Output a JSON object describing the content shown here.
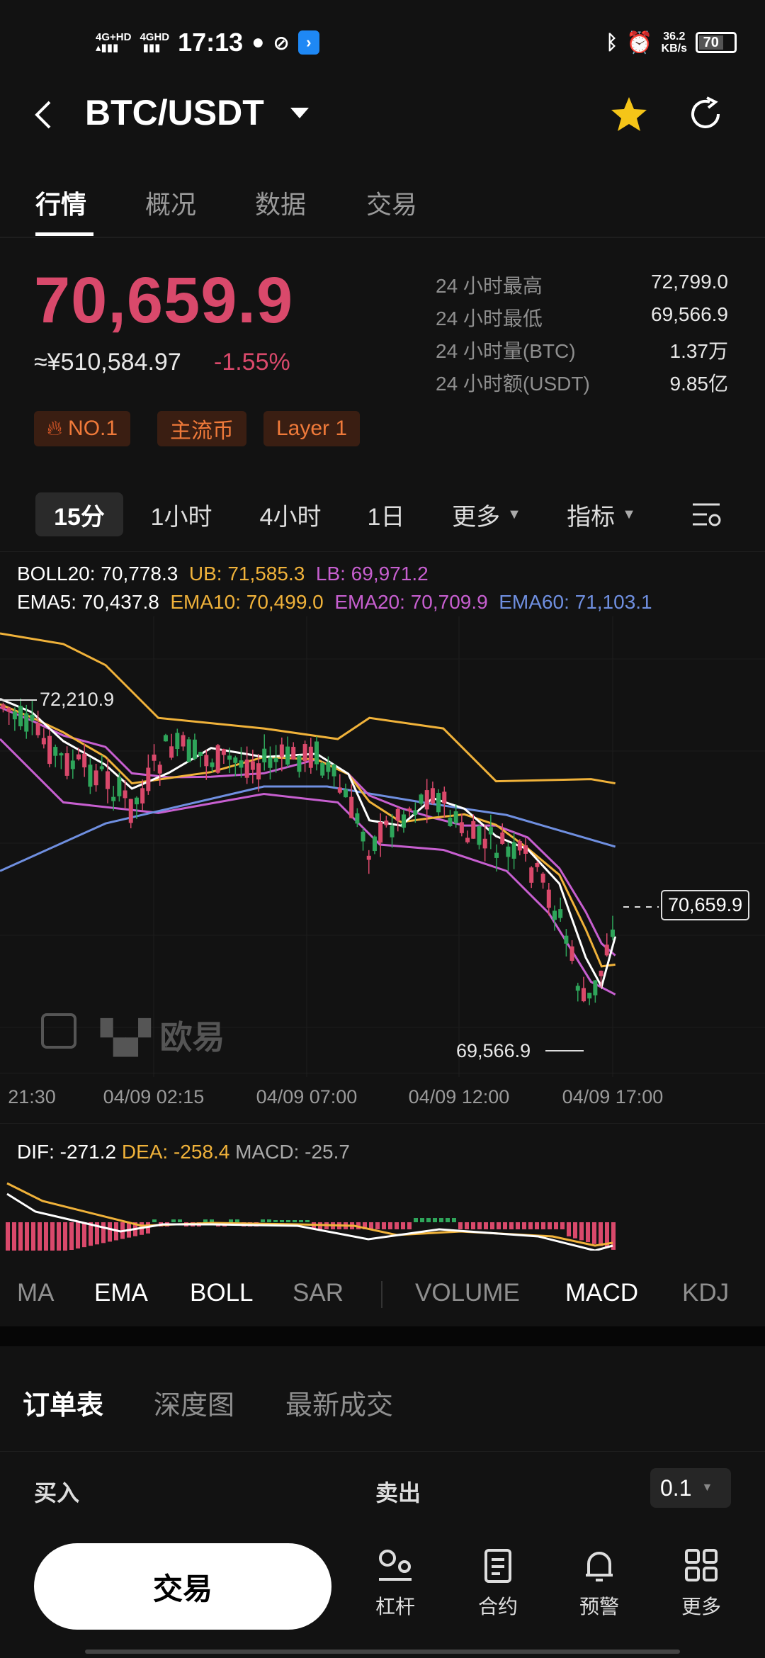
{
  "status_bar": {
    "net1": "4G+HD",
    "net2": "4GHD",
    "time": "17:13",
    "speed_value": "36.2",
    "speed_unit": "KB/s",
    "battery": "70"
  },
  "header": {
    "title": "BTC/USDT"
  },
  "tabs": [
    "行情",
    "概况",
    "数据",
    "交易"
  ],
  "ticker": {
    "price": "70,659.9",
    "cny": "≈¥510,584.97",
    "change": "-1.55%",
    "stats": [
      {
        "label": "24 小时最高",
        "value": "72,799.0"
      },
      {
        "label": "24 小时最低",
        "value": "69,566.9"
      },
      {
        "label": "24 小时量(BTC)",
        "value": "1.37万"
      },
      {
        "label": "24 小时额(USDT)",
        "value": "9.85亿"
      }
    ],
    "badges": [
      "NO.1",
      "主流币",
      "Layer 1"
    ]
  },
  "timeframes": {
    "items": [
      "15分",
      "1小时",
      "4小时",
      "1日"
    ],
    "more": "更多",
    "indicators": "指标"
  },
  "legend": {
    "boll": "BOLL20: 70,778.3",
    "ub": "UB: 71,585.3",
    "lb": "LB: 69,971.2",
    "ema5": "EMA5: 70,437.8",
    "ema10": "EMA10: 70,499.0",
    "ema20": "EMA20: 70,709.9",
    "ema60": "EMA60: 71,103.1"
  },
  "chart": {
    "high_label": "72,210.9",
    "low_label": "69,566.9",
    "last_price": "70,659.9",
    "watermark": "欧易",
    "x_labels": [
      "21:30",
      "04/09 02:15",
      "04/09 07:00",
      "04/09 12:00",
      "04/09 17:00"
    ]
  },
  "macd": {
    "dif": "DIF: -271.2",
    "dea": "DEA: -258.4",
    "macd": "MACD: -25.7"
  },
  "indicator_tabs": [
    "MA",
    "EMA",
    "BOLL",
    "SAR",
    "VOLUME",
    "MACD",
    "KDJ"
  ],
  "order_tabs": [
    "订单表",
    "深度图",
    "最新成交"
  ],
  "orderbook": {
    "buy": "买入",
    "sell": "卖出",
    "precision": "0.1"
  },
  "bottom": {
    "trade": "交易",
    "nav": [
      "杠杆",
      "合约",
      "预警",
      "更多"
    ]
  },
  "colors": {
    "up": "#2ea55a",
    "down": "#d9496b",
    "ub": "#f0b23a",
    "lb": "#c75fd0",
    "ema60": "#6f8fe0"
  }
}
